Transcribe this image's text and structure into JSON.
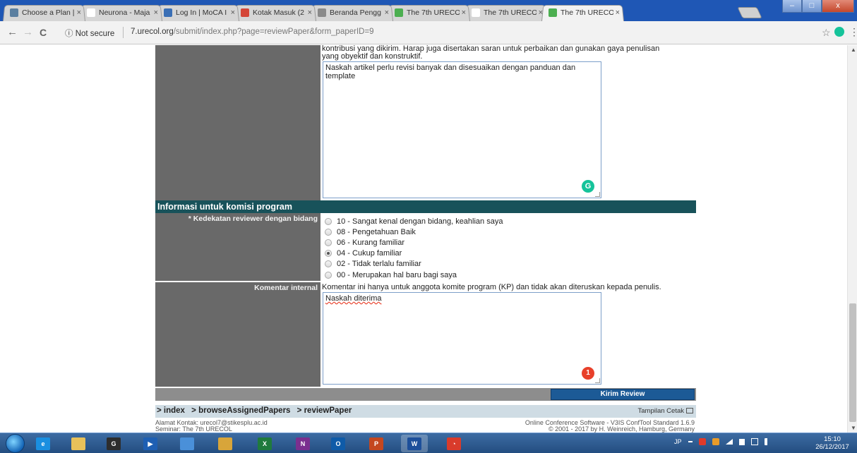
{
  "browser": {
    "tabs": [
      {
        "title": "Choose a Plan |",
        "favicon_color": "#5b7fa0"
      },
      {
        "title": "Neurona - Maja",
        "favicon_color": "#ffffff"
      },
      {
        "title": "Log In | MoCA I",
        "favicon_color": "#3a6fb5"
      },
      {
        "title": "Kotak Masuk (2",
        "favicon_color": "#d44638"
      },
      {
        "title": "Beranda Pengg",
        "favicon_color": "#8a8a8a"
      },
      {
        "title": "The 7th URECO",
        "favicon_color": "#4caf50"
      },
      {
        "title": "The 7th URECO",
        "favicon_color": "#ffffff"
      },
      {
        "title": "The 7th URECO",
        "favicon_color": "#4caf50",
        "active": true
      }
    ],
    "tab_close_glyph": "×",
    "security_label": "ⓘ Not secure",
    "url_host": "7.urecol.org",
    "url_path": "/submit/index.php?page=reviewPaper&form_paperID=9",
    "back_glyph": "←",
    "forward_glyph": "→",
    "reload_glyph": "C",
    "star_glyph": "☆",
    "menu_glyph": "⋮",
    "window_buttons": [
      "–",
      "□",
      "x"
    ]
  },
  "form": {
    "review_help_line1": "kontribusi yang dikirim. Harap juga disertakan saran untuk perbaikan dan gunakan gaya penulisan",
    "review_help_line2": "yang obyektif dan konstruktif.",
    "review_text": "Naskah artikel perlu revisi banyak dan disesuaikan dengan panduan dan template",
    "grammarly_glyph": "G",
    "section_title": "Informasi untuk komisi program",
    "expertise_label": "* Kedekatan reviewer dengan bidang",
    "expertise_options": [
      {
        "label": "10 - Sangat kenal dengan bidang, keahlian saya",
        "checked": false
      },
      {
        "label": "08 - Pengetahuan Baik",
        "checked": false
      },
      {
        "label": "06 - Kurang familiar",
        "checked": false
      },
      {
        "label": "04 - Cukup familiar",
        "checked": true
      },
      {
        "label": "02 - Tidak terlalu familiar",
        "checked": false
      },
      {
        "label": "00 - Merupakan hal baru bagi saya",
        "checked": false
      }
    ],
    "internal_label": "Komentar internal",
    "internal_help": "Komentar ini hanya untuk anggota komite program (KP) dan tidak akan diteruskan kepada penulis.",
    "internal_text": "Naskah diterima",
    "error_count": "1",
    "submit_label": "Kirim Review"
  },
  "breadcrumb": {
    "items": [
      "> index",
      "> browseAssignedPapers",
      "> reviewPaper"
    ],
    "print_label": "Tampilan Cetak"
  },
  "footer": {
    "contact": "Alamat Kontak: urecol7@stikesplu.ac.id",
    "seminar": "Seminar: The 7th URECOL",
    "software": "Online Conference Software - V3IS ConfTool Standard 1.6.9",
    "copyright": "© 2001 - 2017 by H. Weinreich, Hamburg, Germany"
  },
  "taskbar": {
    "apps": [
      {
        "name": "internet-explorer-icon",
        "glyph": "e",
        "color": "#1a8fe0"
      },
      {
        "name": "file-explorer-icon",
        "glyph": "",
        "color": "#e8c15a"
      },
      {
        "name": "app-icon-g",
        "glyph": "G",
        "color": "#2d2d2d"
      },
      {
        "name": "media-player-icon",
        "glyph": "▶",
        "color": "#1e5fb3"
      },
      {
        "name": "chrome-icon",
        "glyph": "",
        "color": "#4a90d9"
      },
      {
        "name": "paint-icon",
        "glyph": "",
        "color": "#d8a53a"
      },
      {
        "name": "excel-icon",
        "glyph": "X",
        "color": "#1f7a3d"
      },
      {
        "name": "onenote-icon",
        "glyph": "N",
        "color": "#7a2f8f"
      },
      {
        "name": "outlook-icon",
        "glyph": "O",
        "color": "#0f5ba8"
      },
      {
        "name": "powerpoint-icon",
        "glyph": "P",
        "color": "#c4471f"
      },
      {
        "name": "word-icon",
        "glyph": "W",
        "color": "#1d4f9a"
      },
      {
        "name": "speedometer-icon",
        "glyph": "◔",
        "color": "#d93b2b"
      }
    ],
    "tray_lang": "JP",
    "clock_time": "15:10",
    "clock_date": "26/12/2017"
  }
}
